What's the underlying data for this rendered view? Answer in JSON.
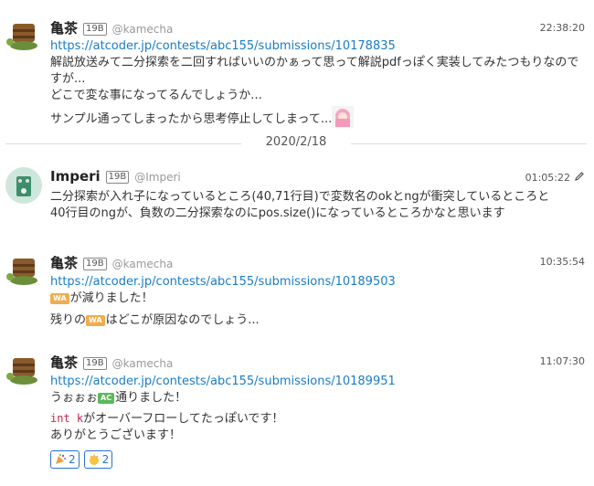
{
  "messages": [
    {
      "name": "亀茶",
      "tag": "19B",
      "handle": "@kamecha",
      "time": "22:38:20",
      "link": "https://atcoder.jp/contests/abc155/submissions/10178835",
      "lines": [
        "解説放送みて二分探索を二回すればいいのかぁって思って解説pdfっぽく実装してみたつもりなのですが...",
        "どこで変な事になってるんでしょうか...",
        "サンプル通ってしまったから思考停止してしまって..."
      ]
    },
    {
      "name": "Imperi",
      "tag": "19B",
      "handle": "@Imperi",
      "time": "01:05:22",
      "lines": [
        "二分探索が入れ子になっているところ(40,71行目)で変数名のokとngが衝突しているところと",
        "40行目のngが、負数の二分探索なのにpos.size()になっているところかなと思います"
      ]
    },
    {
      "name": "亀茶",
      "tag": "19B",
      "handle": "@kamecha",
      "time": "10:35:54",
      "link": "https://atcoder.jp/contests/abc155/submissions/10189503",
      "line1_badge": "WA",
      "line1_text": "が減りました！",
      "line2_pre": "残りの",
      "line2_badge": "WA",
      "line2_text": "はどこが原因なのでしょう..."
    },
    {
      "name": "亀茶",
      "tag": "19B",
      "handle": "@kamecha",
      "time": "11:07:30",
      "link": "https://atcoder.jp/contests/abc155/submissions/10189951",
      "line1_pre": "うぉぉぉ",
      "line1_badge": "AC",
      "line1_text": "通りました！",
      "line2_code": "int k",
      "line2_text": "がオーバーフローしてたっぽいです！",
      "line3": "ありがとうございます！",
      "reactions": [
        {
          "icon": "party-popper-icon",
          "count": "2"
        },
        {
          "icon": "clap-icon",
          "count": "2"
        }
      ]
    }
  ],
  "date_divider": "2020/2/18"
}
